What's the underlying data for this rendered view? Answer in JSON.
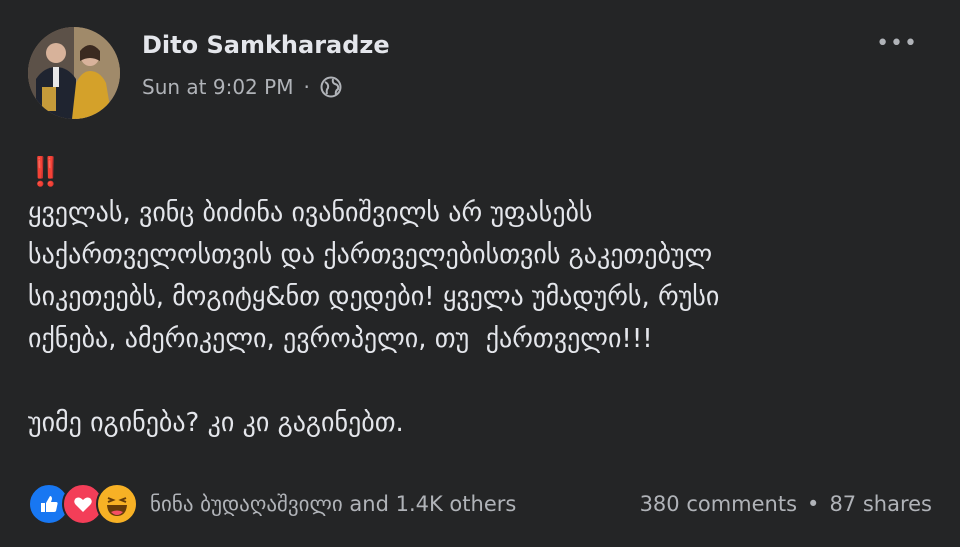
{
  "post": {
    "author": "Dito Samkharadze",
    "timestamp": "Sun at 9:02 PM",
    "separator": "·",
    "more_label": "•••",
    "emoji": "‼️",
    "text": "ყველას, ვინც ბიძინა ივანიშვილს არ უფასებს\nსაქართველოსთვის და ქართველებისთვის გაკეთებულ\nსიკეთეებს, მოგიტყ&ნთ დედები! ყველა უმადურს, რუსი\nიქნება, ამერიკელი, ევროპელი, თუ  ქართველი!!!\n\nუიმე იგინება? კი კი გაგინებთ."
  },
  "footer": {
    "reactions": [
      "like-icon",
      "love-icon",
      "haha-icon"
    ],
    "reactors_text": "ნინა ბუდაღაშვილი and 1.4K others",
    "comments": "380 comments",
    "separator": "•",
    "shares": "87 shares"
  },
  "colors": {
    "background": "#242526",
    "primary_text": "#e4e6eb",
    "secondary_text": "#b0b3b8",
    "like": "#1877f2",
    "love": "#f33e58",
    "haha": "#f7b125",
    "emoji_red": "#f02849"
  }
}
